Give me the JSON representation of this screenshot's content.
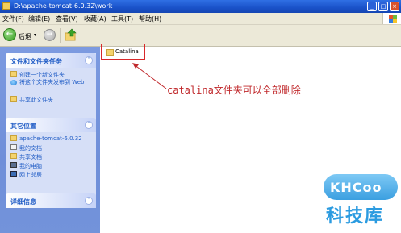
{
  "window": {
    "title": "D:\\apache-tomcat-6.0.32\\work"
  },
  "menu": [
    {
      "label": "文件(F)"
    },
    {
      "label": "编辑(E)"
    },
    {
      "label": "查看(V)"
    },
    {
      "label": "收藏(A)"
    },
    {
      "label": "工具(T)"
    },
    {
      "label": "帮助(H)"
    }
  ],
  "toolbar": {
    "back_label": "后退",
    "back_dropdown": "▾"
  },
  "panels": {
    "tasks": {
      "title": "文件和文件夹任务",
      "items": [
        {
          "label": "创建一个新文件夹",
          "icon": "new-folder-icon"
        },
        {
          "label": "将这个文件夹发布到 Web",
          "icon": "publish-web-icon"
        },
        {
          "label": "共享此文件夹",
          "icon": "share-folder-icon"
        }
      ]
    },
    "places": {
      "title": "其它位置",
      "items": [
        {
          "label": "apache-tomcat-6.0.32",
          "icon": "folder-icon"
        },
        {
          "label": "我的文档",
          "icon": "my-documents-icon"
        },
        {
          "label": "共享文档",
          "icon": "shared-documents-icon"
        },
        {
          "label": "我的电脑",
          "icon": "my-computer-icon"
        },
        {
          "label": "网上邻居",
          "icon": "network-places-icon"
        }
      ]
    },
    "details": {
      "title": "详细信息"
    }
  },
  "content": {
    "folder": {
      "label": "Catalina"
    },
    "annotation": "catalina文件夹可以全部删除"
  },
  "watermark": {
    "logo": "KHCoo",
    "name": "科技库"
  },
  "colors": {
    "title_bar": "#1a52c9",
    "task_pane": "#7393da",
    "annotation": "#c0282b"
  }
}
